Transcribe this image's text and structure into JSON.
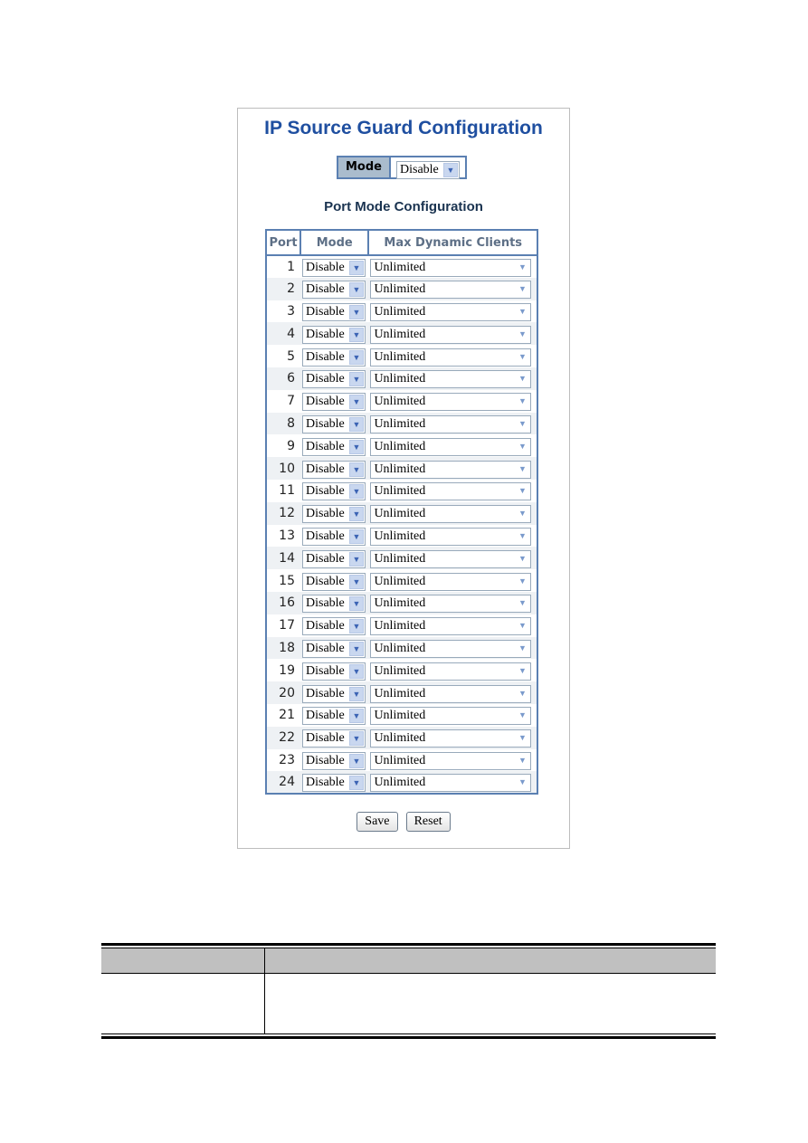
{
  "title": "IP Source Guard Configuration",
  "global_mode": {
    "label": "Mode",
    "value": "Disable"
  },
  "port_section_title": "Port Mode Configuration",
  "columns": [
    "Port",
    "Mode",
    "Max Dynamic Clients"
  ],
  "rows": [
    {
      "port": "1",
      "mode": "Disable",
      "max": "Unlimited"
    },
    {
      "port": "2",
      "mode": "Disable",
      "max": "Unlimited"
    },
    {
      "port": "3",
      "mode": "Disable",
      "max": "Unlimited"
    },
    {
      "port": "4",
      "mode": "Disable",
      "max": "Unlimited"
    },
    {
      "port": "5",
      "mode": "Disable",
      "max": "Unlimited"
    },
    {
      "port": "6",
      "mode": "Disable",
      "max": "Unlimited"
    },
    {
      "port": "7",
      "mode": "Disable",
      "max": "Unlimited"
    },
    {
      "port": "8",
      "mode": "Disable",
      "max": "Unlimited"
    },
    {
      "port": "9",
      "mode": "Disable",
      "max": "Unlimited"
    },
    {
      "port": "10",
      "mode": "Disable",
      "max": "Unlimited"
    },
    {
      "port": "11",
      "mode": "Disable",
      "max": "Unlimited"
    },
    {
      "port": "12",
      "mode": "Disable",
      "max": "Unlimited"
    },
    {
      "port": "13",
      "mode": "Disable",
      "max": "Unlimited"
    },
    {
      "port": "14",
      "mode": "Disable",
      "max": "Unlimited"
    },
    {
      "port": "15",
      "mode": "Disable",
      "max": "Unlimited"
    },
    {
      "port": "16",
      "mode": "Disable",
      "max": "Unlimited"
    },
    {
      "port": "17",
      "mode": "Disable",
      "max": "Unlimited"
    },
    {
      "port": "18",
      "mode": "Disable",
      "max": "Unlimited"
    },
    {
      "port": "19",
      "mode": "Disable",
      "max": "Unlimited"
    },
    {
      "port": "20",
      "mode": "Disable",
      "max": "Unlimited"
    },
    {
      "port": "21",
      "mode": "Disable",
      "max": "Unlimited"
    },
    {
      "port": "22",
      "mode": "Disable",
      "max": "Unlimited"
    },
    {
      "port": "23",
      "mode": "Disable",
      "max": "Unlimited"
    },
    {
      "port": "24",
      "mode": "Disable",
      "max": "Unlimited"
    }
  ],
  "buttons": {
    "save": "Save",
    "reset": "Reset"
  },
  "icons": {
    "dropdown": "chevron-down-icon"
  }
}
